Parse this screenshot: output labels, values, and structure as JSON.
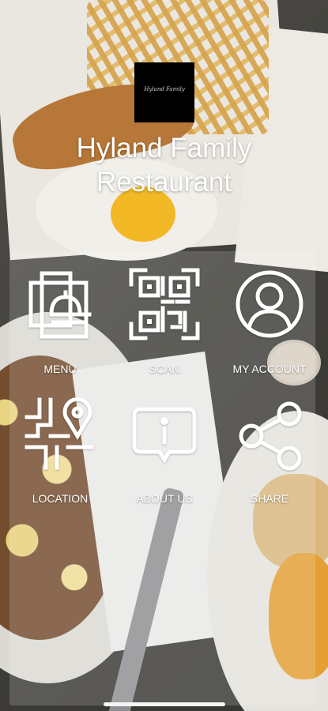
{
  "header": {
    "logo_text": "Hyland Family",
    "title": "Hyland Family\nRestaurant"
  },
  "menu": [
    {
      "id": "menu",
      "label": "MENU",
      "icon": "menu-cloche-icon"
    },
    {
      "id": "scan",
      "label": "SCAN",
      "icon": "qr-code-icon"
    },
    {
      "id": "my-account",
      "label": "MY ACCOUNT",
      "icon": "user-icon"
    },
    {
      "id": "location",
      "label": "LOCATION",
      "icon": "map-pin-icon"
    },
    {
      "id": "about-us",
      "label": "ABOUT US",
      "icon": "info-bubble-icon"
    },
    {
      "id": "share",
      "label": "SHARE",
      "icon": "share-icon"
    }
  ],
  "colors": {
    "text": "#ffffff",
    "logo_bg": "#000000"
  }
}
